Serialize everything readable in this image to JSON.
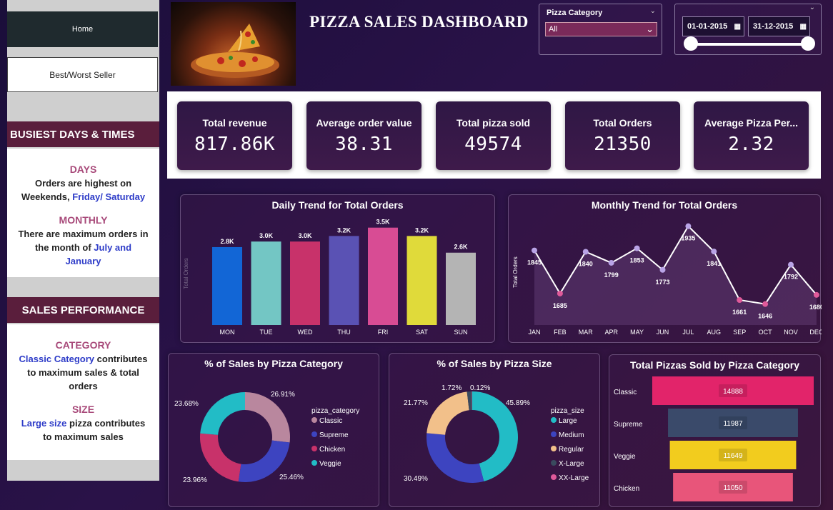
{
  "sidebar": {
    "home": "Home",
    "best_worst": "Best/Worst Seller",
    "busiest_header": "BUSIEST DAYS & TIMES",
    "days_title": "DAYS",
    "days_text1": "Orders are highest on",
    "days_text2": "Weekends, ",
    "days_highlight": "Friday/ Saturday",
    "monthly_title": "MONTHLY",
    "monthly_text1": "There are maximum orders in",
    "monthly_text2": "the month of ",
    "monthly_highlight1": "July and",
    "monthly_highlight2": "January",
    "sales_header": "SALES PERFORMANCE",
    "category_title": "CATEGORY",
    "category_highlight": "Classic Category",
    "category_text1": " contributes",
    "category_text2": "to maximum sales & total",
    "category_text3": "orders",
    "size_title": "SIZE",
    "size_highlight": "Large size",
    "size_text1": " pizza contributes",
    "size_text2": "to maximum sales"
  },
  "header": {
    "title": "PIZZA SALES DASHBOARD",
    "category_slicer_label": "Pizza Category",
    "category_selected": "All",
    "date_start": "01-01-2015",
    "date_end": "31-12-2015"
  },
  "kpis": [
    {
      "label": "Total revenue",
      "value": "817.86K"
    },
    {
      "label": "Average order value",
      "value": "38.31"
    },
    {
      "label": "Total pizza sold",
      "value": "49574"
    },
    {
      "label": "Total Orders",
      "value": "21350"
    },
    {
      "label": "Average Pizza Per...",
      "value": "2.32"
    }
  ],
  "chart_data": [
    {
      "type": "bar",
      "title": "Daily Trend for Total Orders",
      "ylabel": "Total Orders",
      "categories": [
        "MON",
        "TUE",
        "WED",
        "THU",
        "FRI",
        "SAT",
        "SUN"
      ],
      "values": [
        2.8,
        3.0,
        3.0,
        3.2,
        3.5,
        3.2,
        2.6
      ],
      "labels": [
        "2.8K",
        "3.0K",
        "3.0K",
        "3.2K",
        "3.5K",
        "3.2K",
        "2.6K"
      ],
      "colors": [
        "#1266d6",
        "#73c6c4",
        "#c8326a",
        "#5a52b4",
        "#d84c94",
        "#e0da3a",
        "#b4b4b4"
      ],
      "ylim": [
        0,
        3.8
      ]
    },
    {
      "type": "line",
      "title": "Monthly Trend for Total Orders",
      "ylabel": "Total Orders",
      "categories": [
        "JAN",
        "FEB",
        "MAR",
        "APR",
        "MAY",
        "JUN",
        "JUL",
        "AUG",
        "SEP",
        "OCT",
        "NOV",
        "DEC"
      ],
      "values": [
        1845,
        1685,
        1840,
        1799,
        1853,
        1773,
        1935,
        1841,
        1661,
        1646,
        1792,
        1680
      ],
      "ylim": [
        1600,
        1950
      ]
    },
    {
      "type": "pie",
      "title": "% of Sales by Pizza Category",
      "legend_title": "pizza_category",
      "categories": [
        "Classic",
        "Supreme",
        "Chicken",
        "Veggie"
      ],
      "values": [
        26.91,
        25.46,
        23.96,
        23.68
      ],
      "labels": [
        "26.91%",
        "25.46%",
        "23.96%",
        "23.68%"
      ],
      "colors": [
        "#b9879e",
        "#3d44c0",
        "#c8326a",
        "#22bcc6"
      ]
    },
    {
      "type": "pie",
      "title": "% of Sales by Pizza Size",
      "legend_title": "pizza_size",
      "categories": [
        "Large",
        "Medium",
        "Regular",
        "X-Large",
        "XX-Large"
      ],
      "values": [
        45.89,
        30.49,
        21.77,
        1.72,
        0.12
      ],
      "labels": [
        "45.89%",
        "30.49%",
        "21.77%",
        "1.72%",
        "0.12%"
      ],
      "colors": [
        "#22bcc6",
        "#3d44c0",
        "#f2c08a",
        "#3a4a5e",
        "#e05a9a"
      ]
    },
    {
      "type": "bar",
      "title": "Total Pizzas Sold by Pizza Category",
      "categories": [
        "Classic",
        "Supreme",
        "Veggie",
        "Chicken"
      ],
      "values": [
        14888,
        11987,
        11649,
        11050
      ],
      "colors": [
        "#e2246a",
        "#3a4a6a",
        "#f2cc1e",
        "#e8557a"
      ]
    }
  ]
}
